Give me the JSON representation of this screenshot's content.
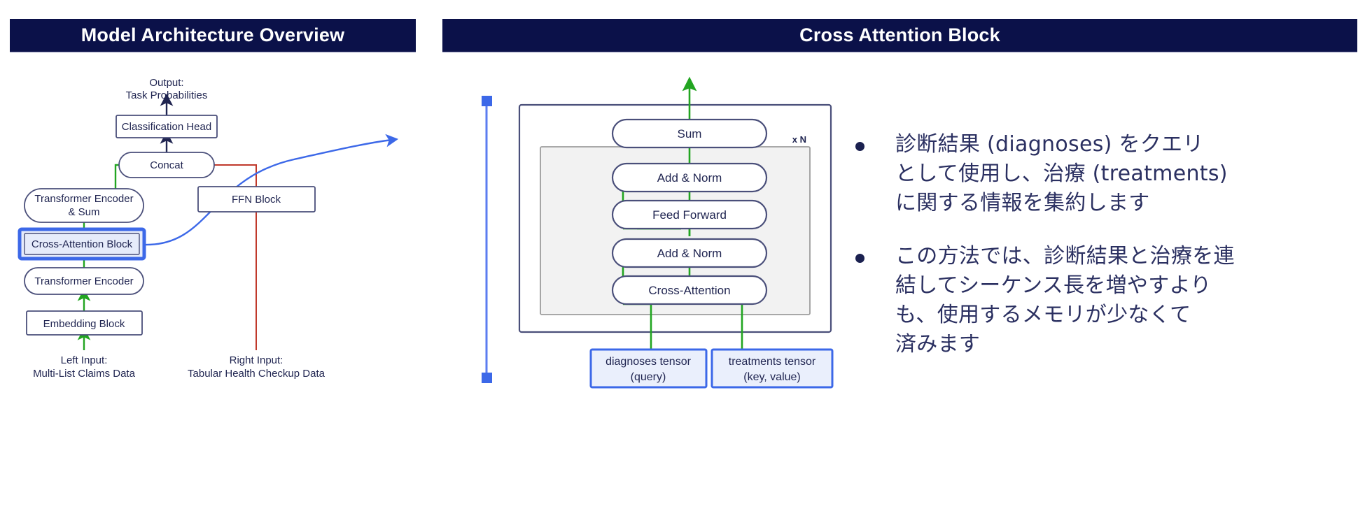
{
  "banners": {
    "left": "Model Architecture Overview",
    "right": "Cross Attention Block"
  },
  "colors": {
    "banner_bg": "#0b1149",
    "banner_text": "#ffffff",
    "node_stroke": "#4a4f7a",
    "node_text": "#1f2450",
    "green_arrow": "#22a521",
    "red_arrow": "#c0392b",
    "dark_arrow": "#1f2450",
    "highlight_blue": "#3c68e8",
    "highlight_fill": "#e6ebfa",
    "inner_group_fill": "#f2f2f2",
    "inner_group_stroke": "#9d9d9d"
  },
  "left_diagram": {
    "title": "Model Architecture Overview",
    "nodes": {
      "output_label": "Output:\nTask Probabilities",
      "output_line1": "Output:",
      "output_line2": "Task Probabilities",
      "classification_head": "Classification Head",
      "concat": "Concat",
      "transformer_encoder_sum_line1": "Transformer Encoder",
      "transformer_encoder_sum_line2": "& Sum",
      "ffn_block": "FFN Block",
      "cross_attention_block": "Cross-Attention Block",
      "transformer_encoder": "Transformer Encoder",
      "embedding_block": "Embedding Block",
      "left_input_line1": "Left Input:",
      "left_input_line2": "Multi-List Claims Data",
      "right_input_line1": "Right Input:",
      "right_input_line2": "Tabular Health Checkup Data"
    }
  },
  "center_diagram": {
    "title": "Cross Attention Block",
    "repeat_label": "x N",
    "nodes": {
      "sum": "Sum",
      "add_norm_top": "Add & Norm",
      "feed_forward": "Feed Forward",
      "add_norm_bottom": "Add & Norm",
      "cross_attention": "Cross-Attention",
      "diagnoses_tensor_line1": "diagnoses tensor",
      "diagnoses_tensor_line2": "(query)",
      "treatments_tensor_line1": "treatments tensor",
      "treatments_tensor_line2": "(key, value)"
    }
  },
  "bullets": [
    "診断結果 (diagnoses) をクエリ\nとして使用し、治療 (treatments)\nに関する情報を集約します",
    "この方法では、診断結果と治療を連\n結してシーケンス長を増やすより\nも、使用するメモリが少なくて\n済みます"
  ]
}
